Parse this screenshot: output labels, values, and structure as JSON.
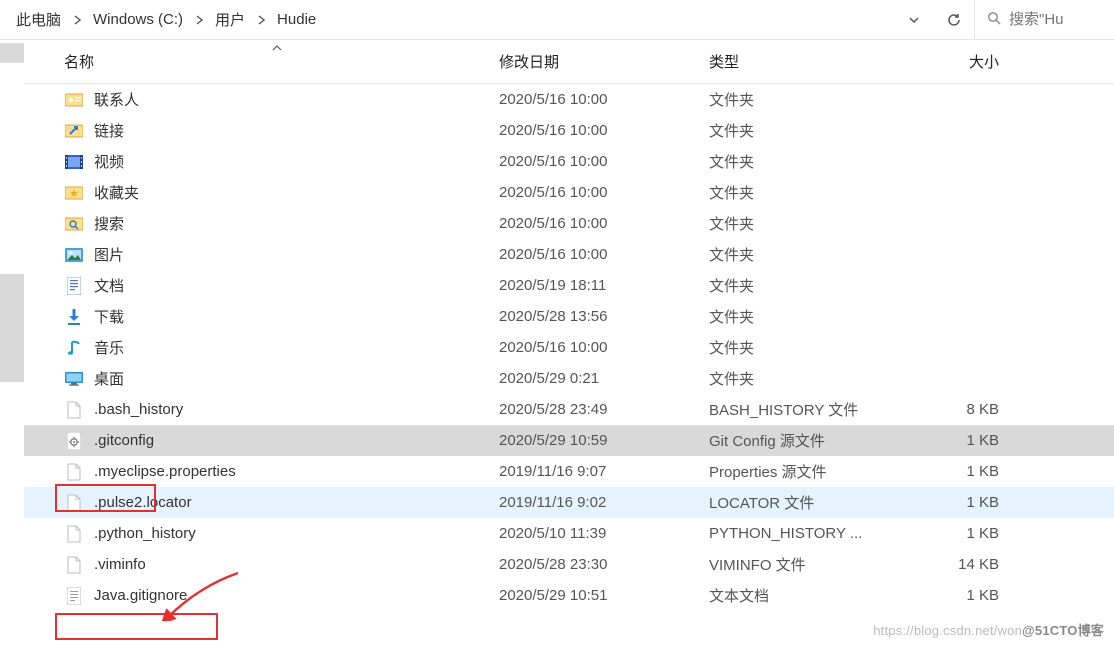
{
  "breadcrumb": {
    "items": [
      "此电脑",
      "Windows (C:)",
      "用户",
      "Hudie"
    ]
  },
  "search": {
    "placeholder": "搜索\"Hu"
  },
  "columns": {
    "name": "名称",
    "date": "修改日期",
    "type": "类型",
    "size": "大小"
  },
  "rows": [
    {
      "icon": "contacts",
      "name": "联系人",
      "date": "2020/5/16 10:00",
      "type": "文件夹",
      "size": ""
    },
    {
      "icon": "links",
      "name": "链接",
      "date": "2020/5/16 10:00",
      "type": "文件夹",
      "size": ""
    },
    {
      "icon": "videos",
      "name": "视频",
      "date": "2020/5/16 10:00",
      "type": "文件夹",
      "size": ""
    },
    {
      "icon": "favorites",
      "name": "收藏夹",
      "date": "2020/5/16 10:00",
      "type": "文件夹",
      "size": ""
    },
    {
      "icon": "search",
      "name": "搜索",
      "date": "2020/5/16 10:00",
      "type": "文件夹",
      "size": ""
    },
    {
      "icon": "pictures",
      "name": "图片",
      "date": "2020/5/16 10:00",
      "type": "文件夹",
      "size": ""
    },
    {
      "icon": "documents",
      "name": "文档",
      "date": "2020/5/19 18:11",
      "type": "文件夹",
      "size": ""
    },
    {
      "icon": "downloads",
      "name": "下载",
      "date": "2020/5/28 13:56",
      "type": "文件夹",
      "size": ""
    },
    {
      "icon": "music",
      "name": "音乐",
      "date": "2020/5/16 10:00",
      "type": "文件夹",
      "size": ""
    },
    {
      "icon": "desktop",
      "name": "桌面",
      "date": "2020/5/29 0:21",
      "type": "文件夹",
      "size": ""
    },
    {
      "icon": "file",
      "name": ".bash_history",
      "date": "2020/5/28 23:49",
      "type": "BASH_HISTORY 文件",
      "size": "8 KB"
    },
    {
      "icon": "cfg",
      "name": ".gitconfig",
      "date": "2020/5/29 10:59",
      "type": "Git Config 源文件",
      "size": "1 KB",
      "state": "selected"
    },
    {
      "icon": "file",
      "name": ".myeclipse.properties",
      "date": "2019/11/16 9:07",
      "type": "Properties 源文件",
      "size": "1 KB"
    },
    {
      "icon": "file",
      "name": ".pulse2.locator",
      "date": "2019/11/16 9:02",
      "type": "LOCATOR 文件",
      "size": "1 KB",
      "state": "hover"
    },
    {
      "icon": "file",
      "name": ".python_history",
      "date": "2020/5/10 11:39",
      "type": "PYTHON_HISTORY ...",
      "size": "1 KB"
    },
    {
      "icon": "file",
      "name": ".viminfo",
      "date": "2020/5/28 23:30",
      "type": "VIMINFO 文件",
      "size": "14 KB"
    },
    {
      "icon": "txt",
      "name": "Java.gitignore",
      "date": "2020/5/29 10:51",
      "type": "文本文档",
      "size": "1 KB"
    }
  ],
  "watermark": {
    "faint": "https://blog.csdn.net/won",
    "bold": "@51CTO博客"
  }
}
